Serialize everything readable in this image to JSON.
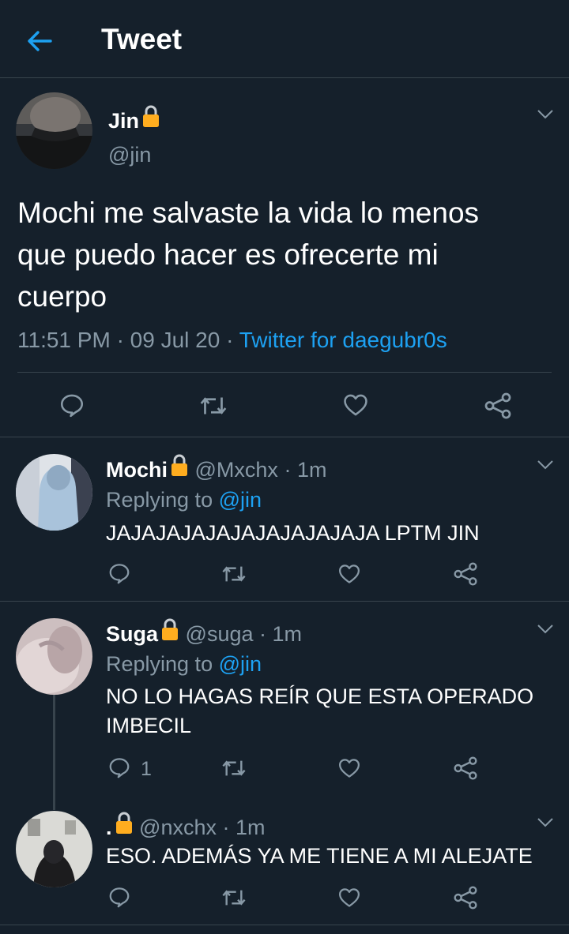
{
  "header": {
    "title": "Tweet"
  },
  "main_tweet": {
    "name": "Jin",
    "handle": "@jin",
    "text_line1": "Mochi me salvaste la vida lo menos",
    "text_line2": "que puedo hacer es ofrecerte mi",
    "text_line3": "cuerpo",
    "time": "11:51 PM",
    "date": "09 Jul 20",
    "sep": "·",
    "source": "Twitter for daegubr0s"
  },
  "replies": [
    {
      "name": "Mochi",
      "handle": "@Mxchx",
      "time": "1m",
      "sep": "·",
      "replying_prefix": "Replying to",
      "replying_handle": "@jin",
      "text_line1": "JAJAJAJAJAJAJAJAJAJAJA LPTM JIN",
      "reply_count": ""
    },
    {
      "name": "Suga",
      "handle": "@suga",
      "time": "1m",
      "sep": "·",
      "replying_prefix": "Replying to",
      "replying_handle": "@jin",
      "text_line1": "NO LO HAGAS REÍR QUE ESTA OPERADO",
      "text_line2": "IMBECIL",
      "reply_count": "1"
    },
    {
      "name": ".",
      "handle": "@nxchx",
      "time": "1m",
      "sep": "·",
      "text_line1": "ESO. ADEMÁS YA ME TIENE A MI ALEJATE",
      "reply_count": ""
    }
  ],
  "colors": {
    "background": "#15202b",
    "accent": "#1da1f2",
    "secondary_text": "#8899a6",
    "divider": "#38444d",
    "lock": "#ffad1f"
  }
}
